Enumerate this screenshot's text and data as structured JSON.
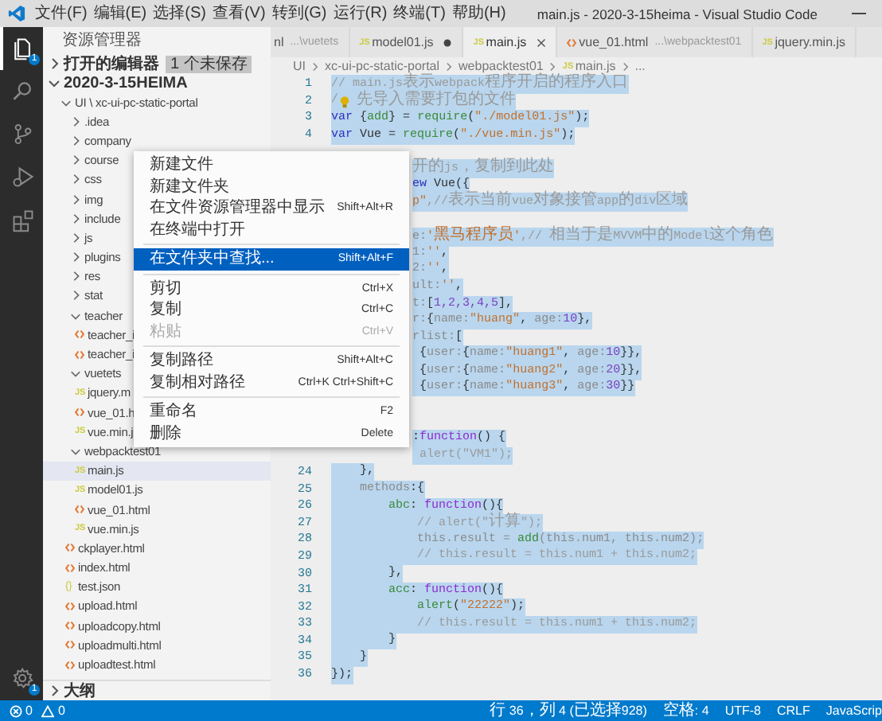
{
  "window": {
    "title": "main.js - 2020-3-15heima - Visual Studio Code",
    "menu": [
      "文件(F)",
      "编辑(E)",
      "选择(S)",
      "查看(V)",
      "转到(G)",
      "运行(R)",
      "终端(T)",
      "帮助(H)"
    ]
  },
  "activity_bar": [
    {
      "kind": "explorer",
      "selected": true,
      "badge": "1"
    },
    {
      "kind": "search",
      "selected": false
    },
    {
      "kind": "source-control",
      "selected": false
    },
    {
      "kind": "run",
      "selected": false
    },
    {
      "kind": "extensions",
      "selected": false
    },
    {
      "kind": "settings",
      "selected": false,
      "badge": "1"
    }
  ],
  "sidebar": {
    "title": "资源管理器",
    "open_editors": {
      "label": "打开的编辑器",
      "expanded": false,
      "badge": "1 个未保存"
    },
    "workspace": {
      "label": "2020-3-15HEIMA",
      "expanded": true
    },
    "tree": [
      {
        "label": "UI \\ xc-ui-pc-static-portal",
        "kind": "folder",
        "expanded": true,
        "selected": false,
        "children": [
          {
            "label": ".idea",
            "kind": "folder",
            "expanded": false,
            "selected": false
          },
          {
            "label": "company",
            "kind": "folder",
            "expanded": false,
            "selected": false
          },
          {
            "label": "course",
            "kind": "folder",
            "expanded": false,
            "selected": false
          },
          {
            "label": "css",
            "kind": "folder",
            "expanded": false,
            "selected": false
          },
          {
            "label": "img",
            "kind": "folder",
            "expanded": false,
            "selected": false
          },
          {
            "label": "include",
            "kind": "folder",
            "expanded": false,
            "selected": false
          },
          {
            "label": "js",
            "kind": "folder",
            "expanded": false,
            "selected": false
          },
          {
            "label": "plugins",
            "kind": "folder",
            "expanded": false,
            "selected": false
          },
          {
            "label": "res",
            "kind": "folder",
            "expanded": false,
            "selected": false
          },
          {
            "label": "stat",
            "kind": "folder",
            "expanded": false,
            "selected": false
          },
          {
            "label": "teacher",
            "kind": "folder",
            "expanded": true,
            "selected": false,
            "children": [
              {
                "label": "teacher_i",
                "kind": "html",
                "selected": false
              },
              {
                "label": "teacher_i",
                "kind": "html",
                "selected": false
              }
            ]
          },
          {
            "label": "vuetets",
            "kind": "folder",
            "expanded": true,
            "selected": false,
            "children": [
              {
                "label": "jquery.m",
                "kind": "js",
                "icon_label": "JS",
                "selected": false
              },
              {
                "label": "vue_01.h",
                "kind": "html",
                "selected": false
              },
              {
                "label": "vue.min.j",
                "kind": "js",
                "icon_label": "JS",
                "selected": false
              }
            ]
          },
          {
            "label": "webpacktest01",
            "kind": "folder",
            "expanded": true,
            "selected": false,
            "children": [
              {
                "label": "main.js",
                "kind": "js",
                "icon_label": "JS",
                "selected": true
              },
              {
                "label": "model01.js",
                "kind": "js",
                "icon_label": "JS",
                "selected": false
              },
              {
                "label": "vue_01.html",
                "kind": "html",
                "selected": false
              },
              {
                "label": "vue.min.js",
                "kind": "js",
                "icon_label": "JS",
                "selected": false
              }
            ]
          },
          {
            "label": "ckplayer.html",
            "kind": "html",
            "selected": false
          },
          {
            "label": "index.html",
            "kind": "html",
            "selected": false
          },
          {
            "label": "test.json",
            "kind": "json",
            "icon_label": "{}",
            "selected": false
          },
          {
            "label": "upload.html",
            "kind": "html",
            "selected": false
          },
          {
            "label": "uploadcopy.html",
            "kind": "html",
            "selected": false
          },
          {
            "label": "uploadmulti.html",
            "kind": "html",
            "selected": false
          },
          {
            "label": "uploadtest.html",
            "kind": "html",
            "selected": false
          }
        ]
      }
    ],
    "outline": {
      "label": "大纲",
      "expanded": false
    }
  },
  "tabs": [
    {
      "label": "nl",
      "description": "...\\vuetets",
      "kind": "plain",
      "selected": false,
      "dirty": false
    },
    {
      "label": "model01.js",
      "kind": "js",
      "icon_label": "JS",
      "selected": false,
      "dirty": true
    },
    {
      "label": "main.js",
      "kind": "js",
      "icon_label": "JS",
      "selected": true,
      "dirty": false
    },
    {
      "label": "vue_01.html",
      "description": "...\\webpacktest01",
      "kind": "html",
      "selected": false,
      "dirty": false
    },
    {
      "label": "jquery.min.js",
      "kind": "js",
      "icon_label": "JS",
      "selected": false,
      "dirty": false
    }
  ],
  "breadcrumb": [
    {
      "label": "UI"
    },
    {
      "label": "xc-ui-pc-static-portal"
    },
    {
      "label": "webpacktest01"
    },
    {
      "label": "main.js",
      "icon_label": "JS"
    },
    {
      "label": "..."
    }
  ],
  "code": [
    {
      "kind": "full",
      "number": "1",
      "tokens": [
        {
          "kind": "comment",
          "text": "// main.js表示webpack程序开启的程序入口"
        }
      ]
    },
    {
      "kind": "full",
      "number": "2",
      "tokens": [
        {
          "kind": "comment",
          "text": "/"
        },
        {
          "kind": "lightbulb"
        },
        {
          "kind": "comment",
          "text": " 先导入需要打包的文件"
        }
      ]
    },
    {
      "kind": "full",
      "number": "3",
      "tokens": [
        {
          "kind": "keyword",
          "text": "var"
        },
        {
          "kind": "plain",
          "text": " {"
        },
        {
          "kind": "fn",
          "text": "add"
        },
        {
          "kind": "plain",
          "text": "} = "
        },
        {
          "kind": "fn",
          "text": "require"
        },
        {
          "kind": "plain",
          "text": "("
        },
        {
          "kind": "string",
          "text": "\"./model01.js\""
        },
        {
          "kind": "plain",
          "text": ");"
        }
      ]
    },
    {
      "kind": "full",
      "number": "4",
      "tokens": [
        {
          "kind": "keyword",
          "text": "var"
        },
        {
          "kind": "plain",
          "text": " Vue = "
        },
        {
          "kind": "fn",
          "text": "require"
        },
        {
          "kind": "plain",
          "text": "("
        },
        {
          "kind": "string",
          "text": "\"./vue.min.js\""
        },
        {
          "kind": "plain",
          "text": ");"
        }
      ]
    },
    {
      "kind": "blank"
    },
    {
      "kind": "covered",
      "tokens": [
        {
          "kind": "comment",
          "text": "开的js，复制到此处"
        }
      ]
    },
    {
      "kind": "covered",
      "tokens": [
        {
          "kind": "keyword",
          "text": "ew"
        },
        {
          "kind": "plain",
          "text": " Vue({"
        }
      ]
    },
    {
      "kind": "covered",
      "tokens": [
        {
          "kind": "string",
          "text": "p\""
        },
        {
          "kind": "comment",
          "text": ",//表示当前vue对象接管app的div区域"
        }
      ]
    },
    {
      "kind": "blank"
    },
    {
      "kind": "covered",
      "tokens": [
        {
          "kind": "prop",
          "text": "e:"
        },
        {
          "kind": "string",
          "text": "'黑马程序员'"
        },
        {
          "kind": "comment",
          "text": ",// 相当于是MVVM中的Model这个角色"
        }
      ]
    },
    {
      "kind": "covered",
      "tokens": [
        {
          "kind": "prop",
          "text": "1:"
        },
        {
          "kind": "string",
          "text": "''"
        },
        {
          "kind": "plain",
          "text": ","
        }
      ]
    },
    {
      "kind": "covered",
      "tokens": [
        {
          "kind": "prop",
          "text": "2:"
        },
        {
          "kind": "string",
          "text": "''"
        },
        {
          "kind": "plain",
          "text": ","
        }
      ]
    },
    {
      "kind": "covered",
      "tokens": [
        {
          "kind": "prop",
          "text": "ult:"
        },
        {
          "kind": "string",
          "text": "''"
        },
        {
          "kind": "plain",
          "text": ","
        }
      ]
    },
    {
      "kind": "covered",
      "tokens": [
        {
          "kind": "prop",
          "text": "t:"
        },
        {
          "kind": "plain",
          "text": "["
        },
        {
          "kind": "number",
          "text": "1,2,3,4,5"
        },
        {
          "kind": "plain",
          "text": "],"
        }
      ]
    },
    {
      "kind": "covered",
      "tokens": [
        {
          "kind": "prop",
          "text": "r:"
        },
        {
          "kind": "plain",
          "text": "{"
        },
        {
          "kind": "prop",
          "text": "name:"
        },
        {
          "kind": "string",
          "text": "\"huang\""
        },
        {
          "kind": "plain",
          "text": ", "
        },
        {
          "kind": "prop",
          "text": "age:"
        },
        {
          "kind": "number",
          "text": "10"
        },
        {
          "kind": "plain",
          "text": "},"
        }
      ]
    },
    {
      "kind": "covered",
      "tokens": [
        {
          "kind": "prop",
          "text": "rlist:"
        },
        {
          "kind": "plain",
          "text": "["
        }
      ]
    },
    {
      "kind": "covered",
      "tokens": [
        {
          "kind": "plain",
          "text": " {"
        },
        {
          "kind": "prop",
          "text": "user:"
        },
        {
          "kind": "plain",
          "text": "{"
        },
        {
          "kind": "prop",
          "text": "name:"
        },
        {
          "kind": "string",
          "text": "\"huang1\""
        },
        {
          "kind": "plain",
          "text": ", "
        },
        {
          "kind": "prop",
          "text": "age:"
        },
        {
          "kind": "number",
          "text": "10"
        },
        {
          "kind": "plain",
          "text": "}},"
        }
      ]
    },
    {
      "kind": "covered",
      "tokens": [
        {
          "kind": "plain",
          "text": " {"
        },
        {
          "kind": "prop",
          "text": "user:"
        },
        {
          "kind": "plain",
          "text": "{"
        },
        {
          "kind": "prop",
          "text": "name:"
        },
        {
          "kind": "string",
          "text": "\"huang2\""
        },
        {
          "kind": "plain",
          "text": ", "
        },
        {
          "kind": "prop",
          "text": "age:"
        },
        {
          "kind": "number",
          "text": "20"
        },
        {
          "kind": "plain",
          "text": "}},"
        }
      ]
    },
    {
      "kind": "covered",
      "tokens": [
        {
          "kind": "plain",
          "text": " {"
        },
        {
          "kind": "prop",
          "text": "user:"
        },
        {
          "kind": "plain",
          "text": "{"
        },
        {
          "kind": "prop",
          "text": "name:"
        },
        {
          "kind": "string",
          "text": "\"huang3\""
        },
        {
          "kind": "plain",
          "text": ", "
        },
        {
          "kind": "prop",
          "text": "age:"
        },
        {
          "kind": "number",
          "text": "30"
        },
        {
          "kind": "plain",
          "text": "}}"
        }
      ]
    },
    {
      "kind": "blank"
    },
    {
      "kind": "blank"
    },
    {
      "kind": "covered",
      "tokens": [
        {
          "kind": "plain",
          "text": ":"
        },
        {
          "kind": "func",
          "text": "function"
        },
        {
          "kind": "plain",
          "text": "() {"
        }
      ]
    },
    {
      "kind": "covered",
      "tokens": [
        {
          "kind": "comment",
          "text": " alert(\"VM1\");"
        }
      ]
    },
    {
      "kind": "full",
      "number": "24",
      "tokens": [
        {
          "kind": "plain",
          "text": "    },"
        }
      ]
    },
    {
      "kind": "full",
      "number": "25",
      "tokens": [
        {
          "kind": "prop",
          "text": "    methods"
        },
        {
          "kind": "plain",
          "text": ":{"
        }
      ]
    },
    {
      "kind": "full",
      "number": "26",
      "tokens": [
        {
          "kind": "fn",
          "text": "        abc"
        },
        {
          "kind": "plain",
          "text": ": "
        },
        {
          "kind": "func",
          "text": "function"
        },
        {
          "kind": "plain",
          "text": "(){"
        }
      ]
    },
    {
      "kind": "full",
      "number": "27",
      "tokens": [
        {
          "kind": "comment",
          "text": "            // alert(\"计算\");"
        }
      ]
    },
    {
      "kind": "full",
      "number": "28",
      "tokens": [
        {
          "kind": "prop",
          "text": "            this.result = "
        },
        {
          "kind": "fn",
          "text": "add"
        },
        {
          "kind": "prop",
          "text": "(this.num1, this.num2);"
        }
      ]
    },
    {
      "kind": "full",
      "number": "29",
      "tokens": [
        {
          "kind": "comment",
          "text": "            // this.result = this.num1 + this.num2;"
        }
      ]
    },
    {
      "kind": "full",
      "number": "30",
      "tokens": [
        {
          "kind": "plain",
          "text": "        },"
        }
      ]
    },
    {
      "kind": "full",
      "number": "31",
      "tokens": [
        {
          "kind": "fn",
          "text": "        acc"
        },
        {
          "kind": "plain",
          "text": ": "
        },
        {
          "kind": "func",
          "text": "function"
        },
        {
          "kind": "plain",
          "text": "(){"
        }
      ]
    },
    {
      "kind": "full",
      "number": "32",
      "tokens": [
        {
          "kind": "fn",
          "text": "            alert"
        },
        {
          "kind": "plain",
          "text": "("
        },
        {
          "kind": "string",
          "text": "\"22222\""
        },
        {
          "kind": "plain",
          "text": ");"
        }
      ]
    },
    {
      "kind": "full",
      "number": "33",
      "tokens": [
        {
          "kind": "comment",
          "text": "            // this.result = this.num1 + this.num2;"
        }
      ]
    },
    {
      "kind": "full",
      "number": "34",
      "tokens": [
        {
          "kind": "plain",
          "text": "        }"
        }
      ]
    },
    {
      "kind": "full",
      "number": "35",
      "tokens": [
        {
          "kind": "plain",
          "text": "    }"
        }
      ]
    },
    {
      "kind": "full",
      "number": "36",
      "tokens": [
        {
          "kind": "plain",
          "text": "});"
        }
      ]
    }
  ],
  "context_menu": [
    {
      "kind": "item",
      "label": "新建文件",
      "selected": false,
      "disabled": false
    },
    {
      "kind": "item",
      "label": "新建文件夹",
      "selected": false,
      "disabled": false
    },
    {
      "kind": "item",
      "label": "在文件资源管理器中显示",
      "shortcut": "Shift+Alt+R",
      "selected": false,
      "disabled": false
    },
    {
      "kind": "item",
      "label": "在终端中打开",
      "selected": false,
      "disabled": false
    },
    {
      "kind": "separator"
    },
    {
      "kind": "item",
      "label": "在文件夹中查找...",
      "shortcut": "Shift+Alt+F",
      "selected": true,
      "disabled": false
    },
    {
      "kind": "separator"
    },
    {
      "kind": "item",
      "label": "剪切",
      "shortcut": "Ctrl+X",
      "selected": false,
      "disabled": false
    },
    {
      "kind": "item",
      "label": "复制",
      "shortcut": "Ctrl+C",
      "selected": false,
      "disabled": false
    },
    {
      "kind": "item",
      "label": "粘贴",
      "shortcut": "Ctrl+V",
      "selected": false,
      "disabled": true
    },
    {
      "kind": "separator"
    },
    {
      "kind": "item",
      "label": "复制路径",
      "shortcut": "Shift+Alt+C",
      "selected": false,
      "disabled": false
    },
    {
      "kind": "item",
      "label": "复制相对路径",
      "shortcut": "Ctrl+K Ctrl+Shift+C",
      "selected": false,
      "disabled": false
    },
    {
      "kind": "separator"
    },
    {
      "kind": "item",
      "label": "重命名",
      "shortcut": "F2",
      "selected": false,
      "disabled": false
    },
    {
      "kind": "item",
      "label": "删除",
      "shortcut": "Delete",
      "selected": false,
      "disabled": false
    }
  ],
  "status_bar": {
    "errors": "0",
    "warnings": "0",
    "items": [
      "行 36，列 4 (已选择928)",
      "空格: 4",
      "UTF-8",
      "CRLF",
      "JavaScrip"
    ]
  }
}
